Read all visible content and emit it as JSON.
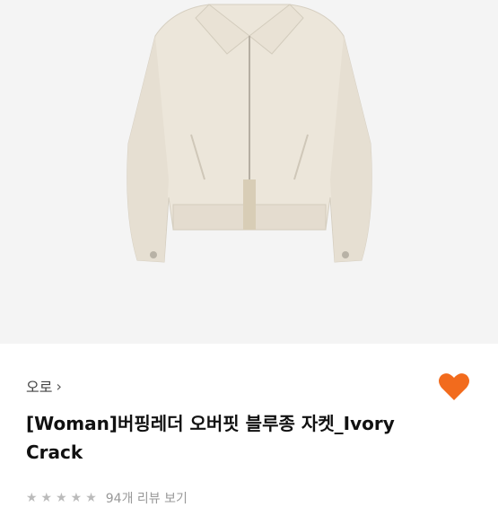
{
  "product": {
    "brand": "오로",
    "title": "[Woman]버핑레더 오버핏 블루종 자켓_Ivory Crack",
    "review_text": "94개 리뷰 보기"
  },
  "icons": {
    "brand_chevron": "chevron-right-icon",
    "wishlist": "heart-icon"
  },
  "colors": {
    "heart": "#f26b1d",
    "jacket": "#ece6da",
    "background": "#f4f4f4"
  }
}
